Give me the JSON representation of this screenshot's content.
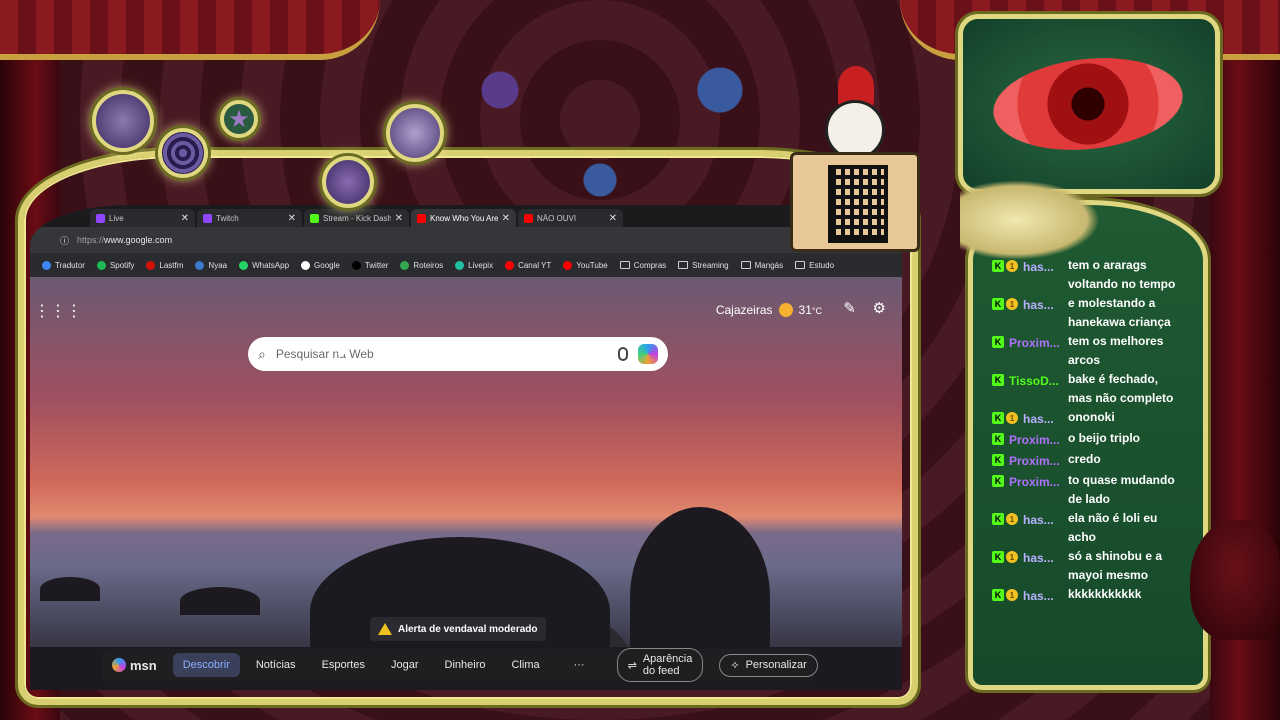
{
  "browser": {
    "tabs": [
      {
        "title": "Live",
        "color": "#9146ff",
        "active": false
      },
      {
        "title": "Twitch",
        "color": "#9146ff",
        "active": false
      },
      {
        "title": "Stream - Kick Dash",
        "color": "#53fc18",
        "active": false
      },
      {
        "title": "Know Who You Are",
        "color": "#ff0000",
        "active": true
      },
      {
        "title": "NÃO OUVI",
        "color": "#ff0000",
        "active": false
      }
    ],
    "url_scheme": "https://",
    "url_host": "www.google.com",
    "bookmarks": [
      {
        "label": "Tradutor",
        "icon": "translate-icon",
        "color": "#4285f4"
      },
      {
        "label": "Spotify",
        "icon": "spotify-icon",
        "color": "#1db954"
      },
      {
        "label": "Lastfm",
        "icon": "lastfm-icon",
        "color": "#d51007"
      },
      {
        "label": "Nyaa",
        "icon": "nyaa-icon",
        "color": "#3a7ad0"
      },
      {
        "label": "WhatsApp",
        "icon": "whatsapp-icon",
        "color": "#25d366"
      },
      {
        "label": "Google",
        "icon": "google-icon",
        "color": "#ffffff"
      },
      {
        "label": "Twitter",
        "icon": "x-icon",
        "color": "#000000"
      },
      {
        "label": "Roteiros",
        "icon": "drive-icon",
        "color": "#34a853"
      },
      {
        "label": "Livepix",
        "icon": "livepix-icon",
        "color": "#20c0a0"
      },
      {
        "label": "Canal YT",
        "icon": "youtube-icon",
        "color": "#ff0000"
      },
      {
        "label": "YouTube",
        "icon": "youtube-icon",
        "color": "#ff0000"
      },
      {
        "label": "Compras",
        "icon": "folder-icon",
        "color": ""
      },
      {
        "label": "Streaming",
        "icon": "folder-icon",
        "color": ""
      },
      {
        "label": "Mangás",
        "icon": "folder-icon",
        "color": ""
      },
      {
        "label": "Estudo",
        "icon": "folder-icon",
        "color": ""
      }
    ]
  },
  "ntp": {
    "city": "Cajazeiras",
    "temp": "31",
    "temp_unit": "°C",
    "search_placeholder": "Pesquisar na Web",
    "alert": "Alerta de vendaval moderado"
  },
  "msn": {
    "logo": "msn",
    "tabs": [
      {
        "label": "Descobrir",
        "active": true
      },
      {
        "label": "Notícias",
        "active": false
      },
      {
        "label": "Esportes",
        "active": false
      },
      {
        "label": "Jogar",
        "active": false
      },
      {
        "label": "Dinheiro",
        "active": false
      },
      {
        "label": "Clima",
        "active": false
      }
    ],
    "more": "···",
    "feed_button": "Aparência do feed",
    "personalize_button": "Personalizar"
  },
  "chat": [
    {
      "user": "has...",
      "user_color": "#b8b0ff",
      "coin": true,
      "msg": "tem o ararags voltando no tempo"
    },
    {
      "user": "has...",
      "user_color": "#b8b0ff",
      "coin": true,
      "msg": "e molestando a hanekawa criança"
    },
    {
      "user": "Proxim...",
      "user_color": "#b070ff",
      "coin": false,
      "msg": "tem os melhores arcos"
    },
    {
      "user": "TissoD...",
      "user_color": "#53fc18",
      "coin": false,
      "msg": "bake é fechado, mas não completo"
    },
    {
      "user": "has...",
      "user_color": "#b8b0ff",
      "coin": true,
      "msg": "ononoki"
    },
    {
      "user": "Proxim...",
      "user_color": "#b070ff",
      "coin": false,
      "msg": "o beijo triplo"
    },
    {
      "user": "Proxim...",
      "user_color": "#b070ff",
      "coin": false,
      "msg": "credo"
    },
    {
      "user": "Proxim...",
      "user_color": "#b070ff",
      "coin": false,
      "msg": "to quase mudando de lado"
    },
    {
      "user": "has...",
      "user_color": "#b8b0ff",
      "coin": true,
      "msg": "ela não é loli eu acho"
    },
    {
      "user": "has...",
      "user_color": "#b8b0ff",
      "coin": true,
      "msg": "só a shinobu e a mayoi mesmo"
    },
    {
      "user": "has...",
      "user_color": "#b8b0ff",
      "coin": true,
      "msg": "kkkkkkkkkkk"
    }
  ],
  "badges": {
    "kick": "K",
    "coin": "1"
  }
}
